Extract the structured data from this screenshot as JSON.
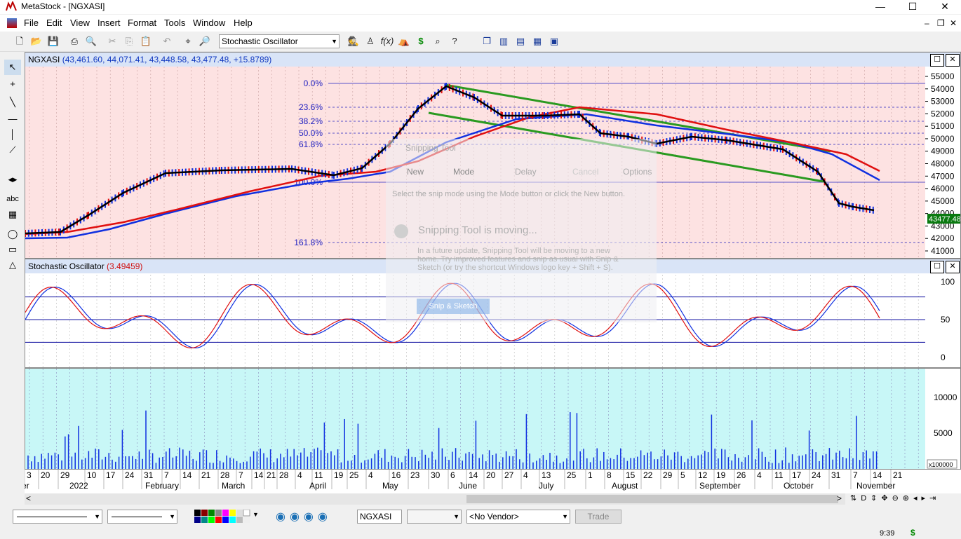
{
  "window": {
    "title": "MetaStock - [NGXASI]"
  },
  "menu": [
    "File",
    "Edit",
    "View",
    "Insert",
    "Format",
    "Tools",
    "Window",
    "Help"
  ],
  "toolbar": {
    "indicator_select": "Stochastic Oscillator"
  },
  "price_panel": {
    "header_symbol": "NGXASI",
    "header_values": "(43,461.60, 44,071.41, 43,448.58, 43,477.48, +15.8789)",
    "last_price_label": "43477.48",
    "price_ticks": [
      55000,
      54000,
      53000,
      52000,
      51000,
      50000,
      49000,
      48000,
      47000,
      46000,
      45000,
      44000,
      43000,
      42000,
      41000
    ],
    "fib_labels": [
      "0.0%",
      "23.6%",
      "38.2%",
      "50.0%",
      "61.8%",
      "100.0%",
      "161.8%"
    ]
  },
  "stoch_panel": {
    "title": "Stochastic Oscillator",
    "value": "(3.49459)",
    "ticks": [
      "100",
      "50",
      "0"
    ]
  },
  "volume_panel": {
    "ticks": [
      "10000",
      "5000"
    ],
    "scale_label": "x100000"
  },
  "date_axis": {
    "days": [
      "3",
      "20",
      "29",
      "10",
      "17",
      "24",
      "31",
      "7",
      "14",
      "21",
      "28",
      "7",
      "14",
      "21",
      "28",
      "4",
      "11",
      "19",
      "25",
      "4",
      "16",
      "23",
      "30",
      "6",
      "14",
      "20",
      "27",
      "4",
      "13",
      "25",
      "1",
      "8",
      "15",
      "22",
      "29",
      "5",
      "12",
      "19",
      "26",
      "4",
      "11",
      "17",
      "24",
      "31",
      "7",
      "14",
      "21"
    ],
    "months": [
      "2022",
      "February",
      "March",
      "April",
      "May",
      "June",
      "July",
      "August",
      "September",
      "October",
      "November"
    ],
    "first_month_fragment": "er"
  },
  "snipping_tool": {
    "title": "Snipping Tool",
    "new": "New",
    "mode": "Mode",
    "delay": "Delay",
    "cancel": "Cancel",
    "options": "Options",
    "instruction": "Select the snip mode using the Mode button or click the New button.",
    "moving_title": "Snipping Tool is moving...",
    "moving_body": "In a future update, Snipping Tool will be moving to a new home. Try improved features and snip as usual with Snip & Sketch (or try the shortcut Windows logo key + Shift + S).",
    "sketch_button": "Snip & Sketch"
  },
  "statusbar": {
    "symbol": "NGXASI",
    "vendor": "<No Vendor>",
    "trade": "Trade",
    "time": "9:39",
    "currency": "$"
  },
  "colors": {
    "price_bg": "#fde2e2",
    "volume_bg": "#c8f7f7",
    "ma_black": "#000000",
    "ma_red": "#e01010",
    "ma_blue": "#1030e0",
    "trend_green": "#2a9a20"
  }
}
